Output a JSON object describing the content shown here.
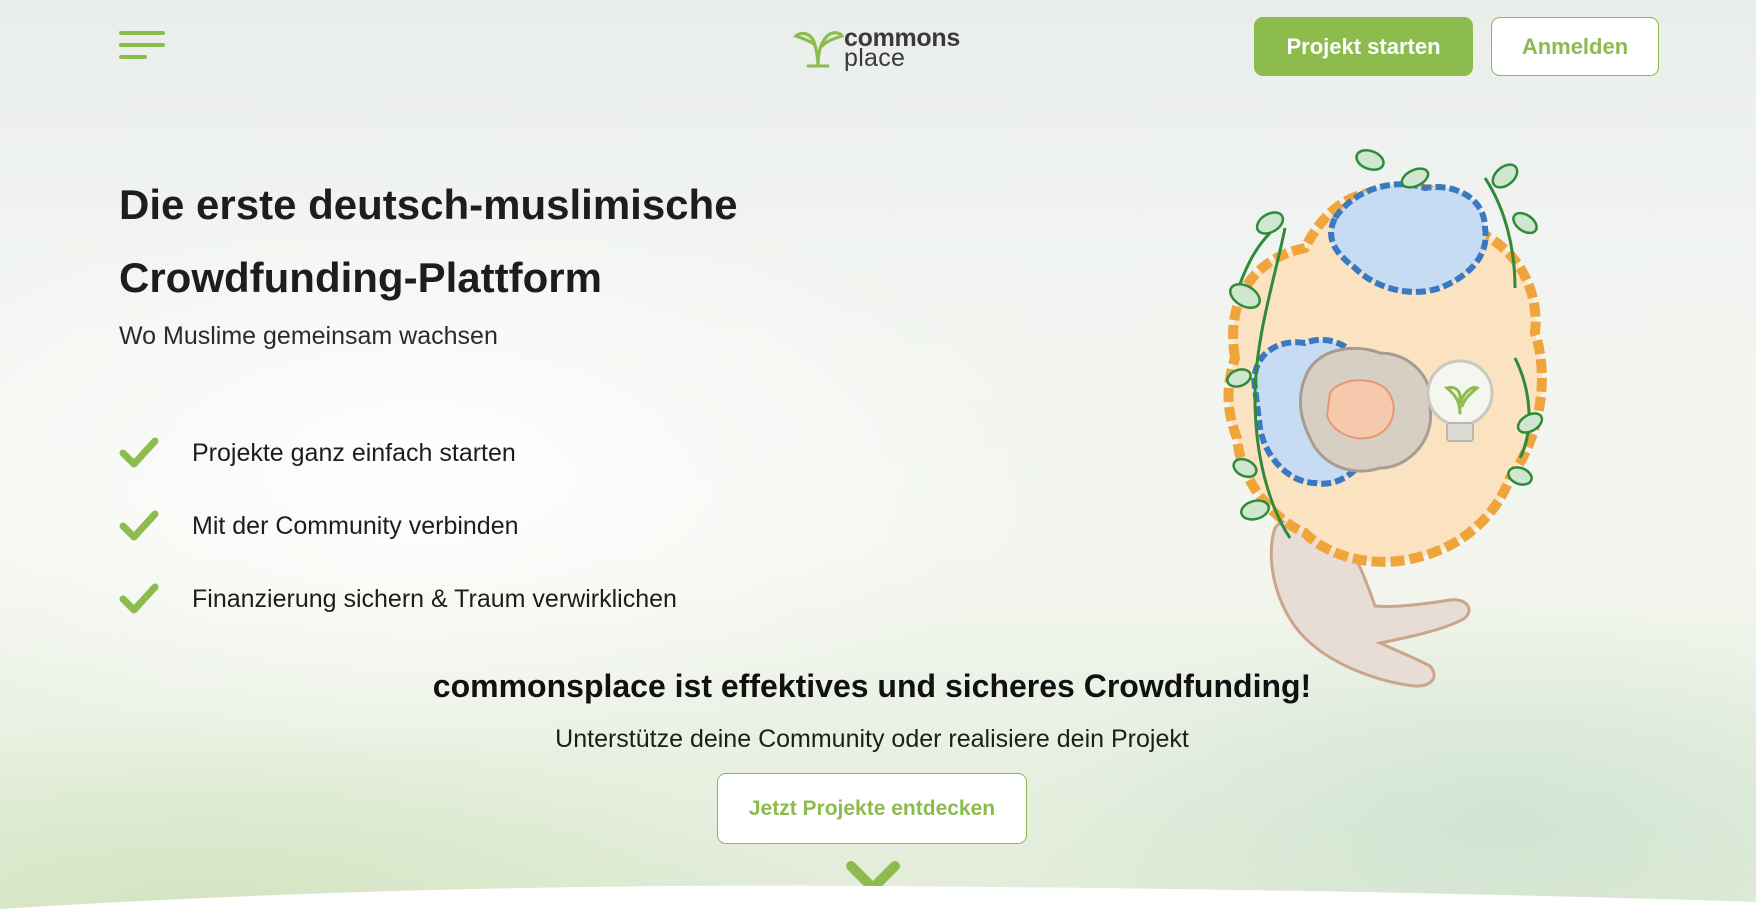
{
  "header": {
    "menu_icon": "hamburger-menu-icon",
    "logo": {
      "line1": "commons",
      "line2": "place",
      "icon": "sprout-cup-icon"
    },
    "start_project_label": "Projekt starten",
    "login_label": "Anmelden"
  },
  "hero": {
    "title_line1": "Die erste deutsch-muslimische",
    "title_line2": "Crowdfunding-Plattform",
    "subtitle": "Wo Muslime gemeinsam wachsen",
    "features": [
      {
        "icon": "checkmark-icon",
        "text": "Projekte ganz einfach starten"
      },
      {
        "icon": "checkmark-icon",
        "text": "Mit der Community verbinden"
      },
      {
        "icon": "checkmark-icon",
        "text": "Finanzierung sichern & Traum verwirklichen"
      }
    ],
    "illustration": "calligraphy-world-hand-illustration"
  },
  "cta": {
    "tagline": "commonsplace ist effektives und sicheres Crowdfunding!",
    "sub": "Unterstütze deine Community oder realisiere dein Projekt",
    "discover_label": "Jetzt Projekte entdecken",
    "scroll_icon": "chevron-down-icon"
  },
  "colors": {
    "accent": "#8cbb4e",
    "text": "#1d1d1b",
    "illustration_orange": "#f0a43c",
    "illustration_blue": "#3a78c2"
  }
}
